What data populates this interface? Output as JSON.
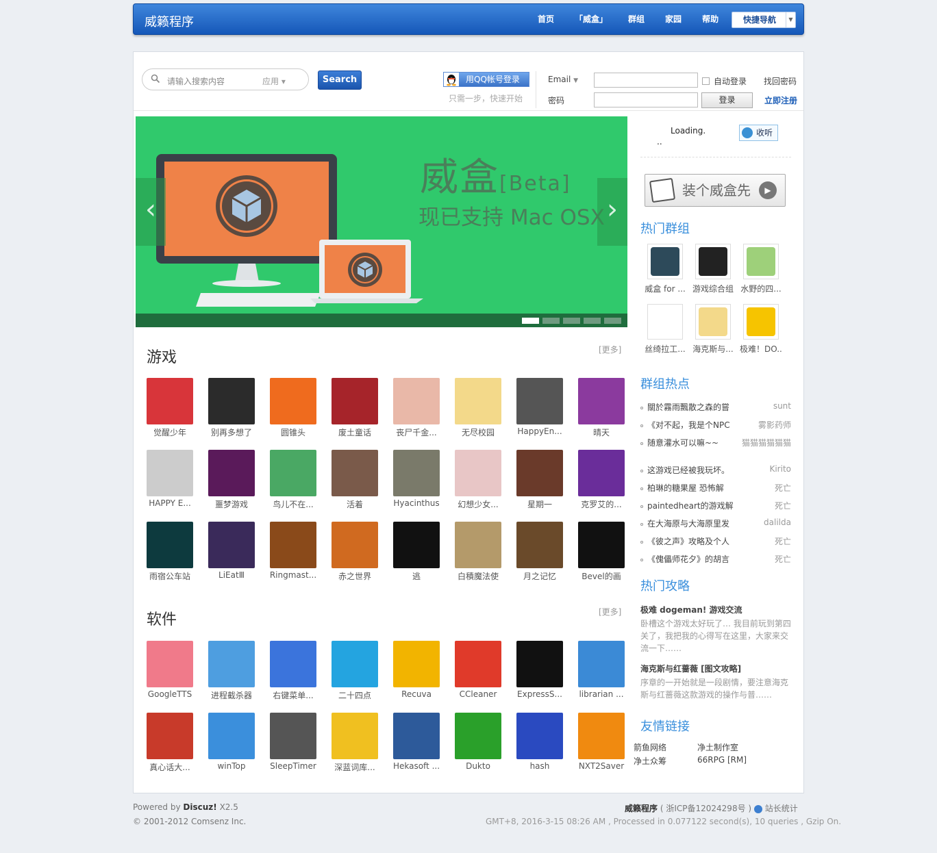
{
  "topbar": {
    "logo": "威籁程序",
    "nav": [
      "首页",
      "「威盒」",
      "群组",
      "家园",
      "帮助"
    ],
    "quicknav": "快捷导航"
  },
  "header": {
    "search_placeholder": "请输入搜索内容",
    "search_scope": "应用",
    "search_button": "Search",
    "qq_login": "用QQ帐号登录",
    "qq_sub": "只需一步，快速开始",
    "email_label": "Email",
    "password_label": "密码",
    "auto_login": "自动登录",
    "forgot": "找回密码",
    "login_button": "登录",
    "register": "立即注册"
  },
  "banner": {
    "title": "威盒",
    "title_suffix": "[Beta]",
    "subtitle": "现已支持 Mac OSX",
    "prev": "‹",
    "next": "›"
  },
  "games": {
    "title": "游戏",
    "more": "[更多]",
    "items": [
      "觉醒少年",
      "别再多想了",
      "圆锥头",
      "废土童话",
      "丧尸千金...",
      "无尽校园",
      "HappyEn...",
      "晴天",
      "HAPPY E...",
      "噩梦游戏",
      "鸟儿不在...",
      "活着",
      "Hyacinthus",
      "幻想少女...",
      "星期一",
      "克罗艾的...",
      "雨宿公车站",
      "LiEatⅢ",
      "Ringmast...",
      "赤之世界",
      "逃",
      "白積魔法使",
      "月之记忆",
      "Bevel的画"
    ]
  },
  "software": {
    "title": "软件",
    "more": "[更多]",
    "items": [
      "GoogleTTS",
      "进程截杀器",
      "右键菜单...",
      "二十四点",
      "Recuva",
      "CCleaner",
      "ExpressS...",
      "librarian ...",
      "真心话大...",
      "winTop",
      "SleepTimer",
      "深蓝词库...",
      "Hekasoft ...",
      "Dukto",
      "hash",
      "NXT2Saver"
    ]
  },
  "sidebar": {
    "radio_loading": "Loading.",
    "radio_dots": "..",
    "radio_button": "收听",
    "install_button": "装个威盒先",
    "hot_groups_title": "热门群组",
    "hot_groups": [
      "威盒 for ...",
      "游戏综合组",
      "水野的四...",
      "丝绮拉工...",
      "海克斯与...",
      "极难！DO..."
    ],
    "group_hot_title": "群组热点",
    "group_hot": [
      {
        "title": "關於霧雨飄散之森的嘗",
        "user": "sunt"
      },
      {
        "title": "《对不起，我是个NPC",
        "user": "雾影药师"
      },
      {
        "title": "随意灌水可以嘛~~",
        "user": "猫猫猫猫猫猫"
      },
      {
        "title": "这游戏已经被我玩坏。",
        "user": "Kirito"
      },
      {
        "title": "柏琳的糖果屋 恐怖解",
        "user": "死亡"
      },
      {
        "title": "paintedheart的游戏解",
        "user": "死亡"
      },
      {
        "title": "在大海原与大海原里发",
        "user": "dalilda"
      },
      {
        "title": "《彼之声》攻略及个人",
        "user": "死亡"
      },
      {
        "title": "《傀儡师花夕》的胡言",
        "user": "死亡"
      }
    ],
    "guides_title": "热门攻略",
    "guides": [
      {
        "title": "极难 dogeman! 游戏交流",
        "desc": "卧槽这个游戏太好玩了… 我目前玩到第四关了，我把我的心得写在这里，大家来交流一下……"
      },
      {
        "title": "海克斯与红蔷薇 [图文攻略]",
        "desc": "序章的一开始就是一段剧情，要注意海克斯与红蔷薇这款游戏的操作与普……"
      }
    ],
    "links_title": "友情链接",
    "links": [
      "箭鱼网络",
      "净土制作室",
      "净土众筹",
      "66RPG [RM]"
    ]
  },
  "footer": {
    "powered": "Powered by",
    "discuz": "Discuz!",
    "version": "X2.5",
    "copyright": "© 2001-2012 Comsenz Inc.",
    "site": "威籁程序",
    "icp": "( 浙ICP备12024298号 )",
    "stats": "站长统计",
    "gzip": "GMT+8, 2016-3-15 08:26 AM , Processed in 0.077122 second(s), 10 queries , Gzip On."
  },
  "colors": {
    "brand_blue": "#1e5fb8",
    "banner_green": "#30c96c",
    "sidebar_title": "#3a8fdc"
  }
}
